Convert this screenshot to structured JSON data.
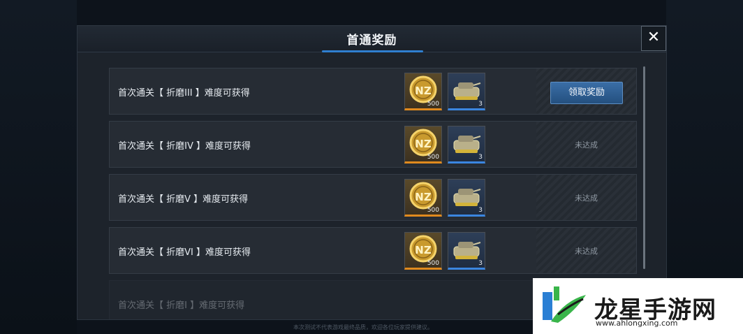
{
  "dialog": {
    "title": "首通奖励",
    "close_label": "✕"
  },
  "rewards": [
    {
      "label": "首次通关【 折磨III 】难度可获得",
      "coin_qty": "500",
      "tank_qty": "3",
      "action": "领取奖励",
      "claimable": true
    },
    {
      "label": "首次通关【 折磨IV 】难度可获得",
      "coin_qty": "500",
      "tank_qty": "3",
      "action": "未达成",
      "claimable": false
    },
    {
      "label": "首次通关【 折磨V 】难度可获得",
      "coin_qty": "500",
      "tank_qty": "3",
      "action": "未达成",
      "claimable": false
    },
    {
      "label": "首次通关【 折磨VI 】难度可获得",
      "coin_qty": "500",
      "tank_qty": "3",
      "action": "未达成",
      "claimable": false
    },
    {
      "label": "首次通关【 折磨I 】难度可获得",
      "coin_qty": "",
      "tank_qty": "",
      "action": "",
      "claimable": false
    }
  ],
  "items": {
    "coin_icon": "nz-coin-icon",
    "tank_icon": "armored-tank-icon"
  },
  "footer": {
    "note": "本次测试不代表游戏最终品质，欢迎各位玩家提供建议。"
  },
  "watermark": {
    "brand": "龙星手游网",
    "url": "www.ahlongxing.com"
  },
  "colors": {
    "coin_bar": "#e08a1e",
    "tank_bar": "#3b86e0",
    "claim_button": "#2f6aa3",
    "tab_underline": "#2f7fcf"
  }
}
